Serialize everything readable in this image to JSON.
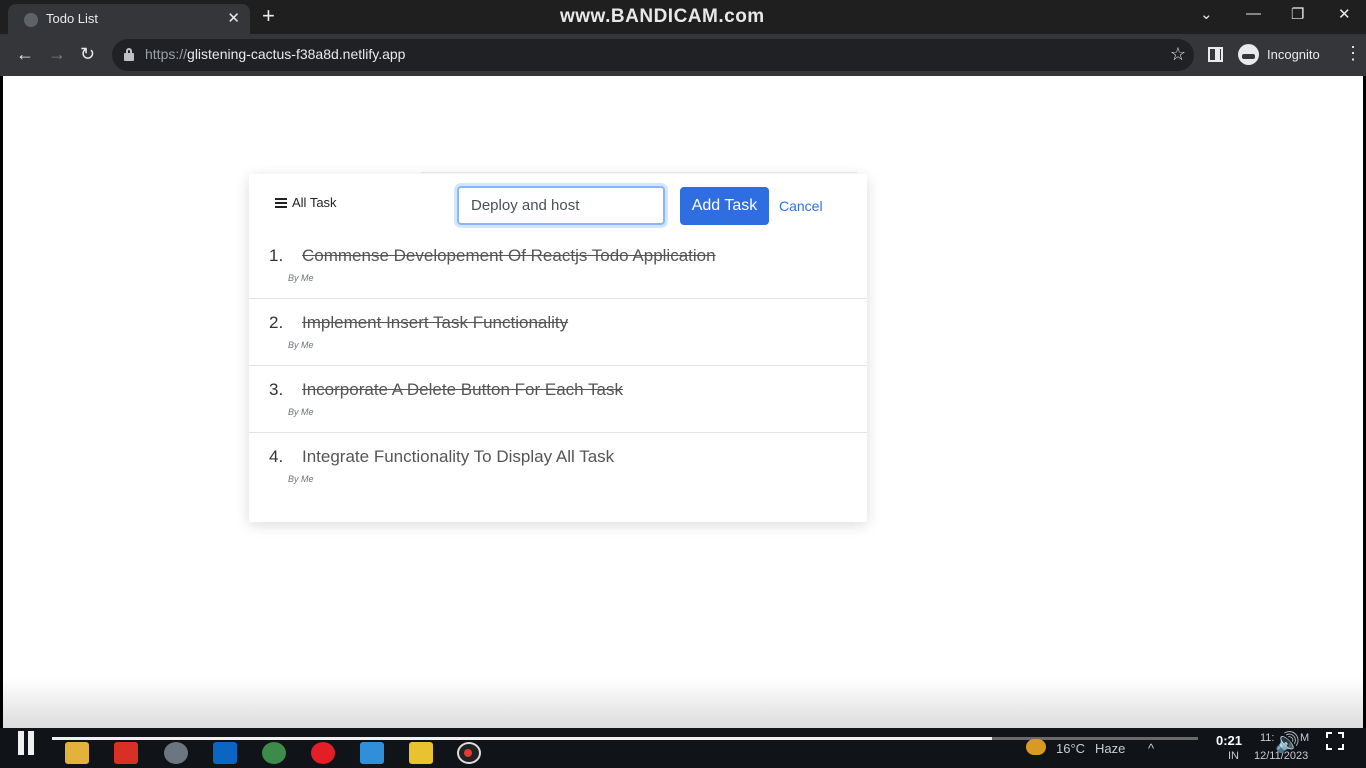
{
  "browser": {
    "tab_title": "Todo List",
    "tab_close": "✕",
    "new_tab": "+",
    "watermark": "www.BANDICAM.com",
    "win_chevron": "⌄",
    "win_minimize": "—",
    "win_restore": "❐",
    "win_close": "✕",
    "back": "←",
    "forward": "→",
    "reload": "↻",
    "url_scheme": "https://",
    "url_host": "glistening-cactus-f38a8d.netlify.app",
    "star": "☆",
    "incognito_label": "Incognito",
    "menu": "⋮"
  },
  "app": {
    "all_task_label": "All Task",
    "input_value": "Deploy and host ",
    "add_button_label": "Add Task",
    "cancel_label": "Cancel",
    "tasks": [
      {
        "number": "1.",
        "text": "Commense Developement Of Reactjs Todo Application",
        "by": "By Me",
        "completed": true
      },
      {
        "number": "2.",
        "text": "Implement Insert Task Functionality",
        "by": "By Me",
        "completed": true
      },
      {
        "number": "3.",
        "text": "Incorporate A Delete Button For Each Task",
        "by": "By Me",
        "completed": true
      },
      {
        "number": "4.",
        "text": "Integrate Functionality To Display All Task",
        "by": "By Me",
        "completed": false
      }
    ]
  },
  "player": {
    "current_time": "0:21",
    "progress": 0.82,
    "volume_glyph": "🔊"
  },
  "taskbar": {
    "weather_temp": "16°C",
    "weather_desc": "Haze",
    "lang": "IN",
    "clock_fragment": "11:",
    "clock_suffix": "M",
    "date": "12/11/2023",
    "tray_up": "^",
    "colors": {
      "explorer": "#e2b33c",
      "gmail": "#d93025",
      "chrome_dev": "#6b7680",
      "linkedin": "#0a66c2",
      "chrome": "#3c8b4a",
      "opera": "#e21f26",
      "vscode": "#2f8fd8",
      "notes": "#e8c22f"
    }
  }
}
